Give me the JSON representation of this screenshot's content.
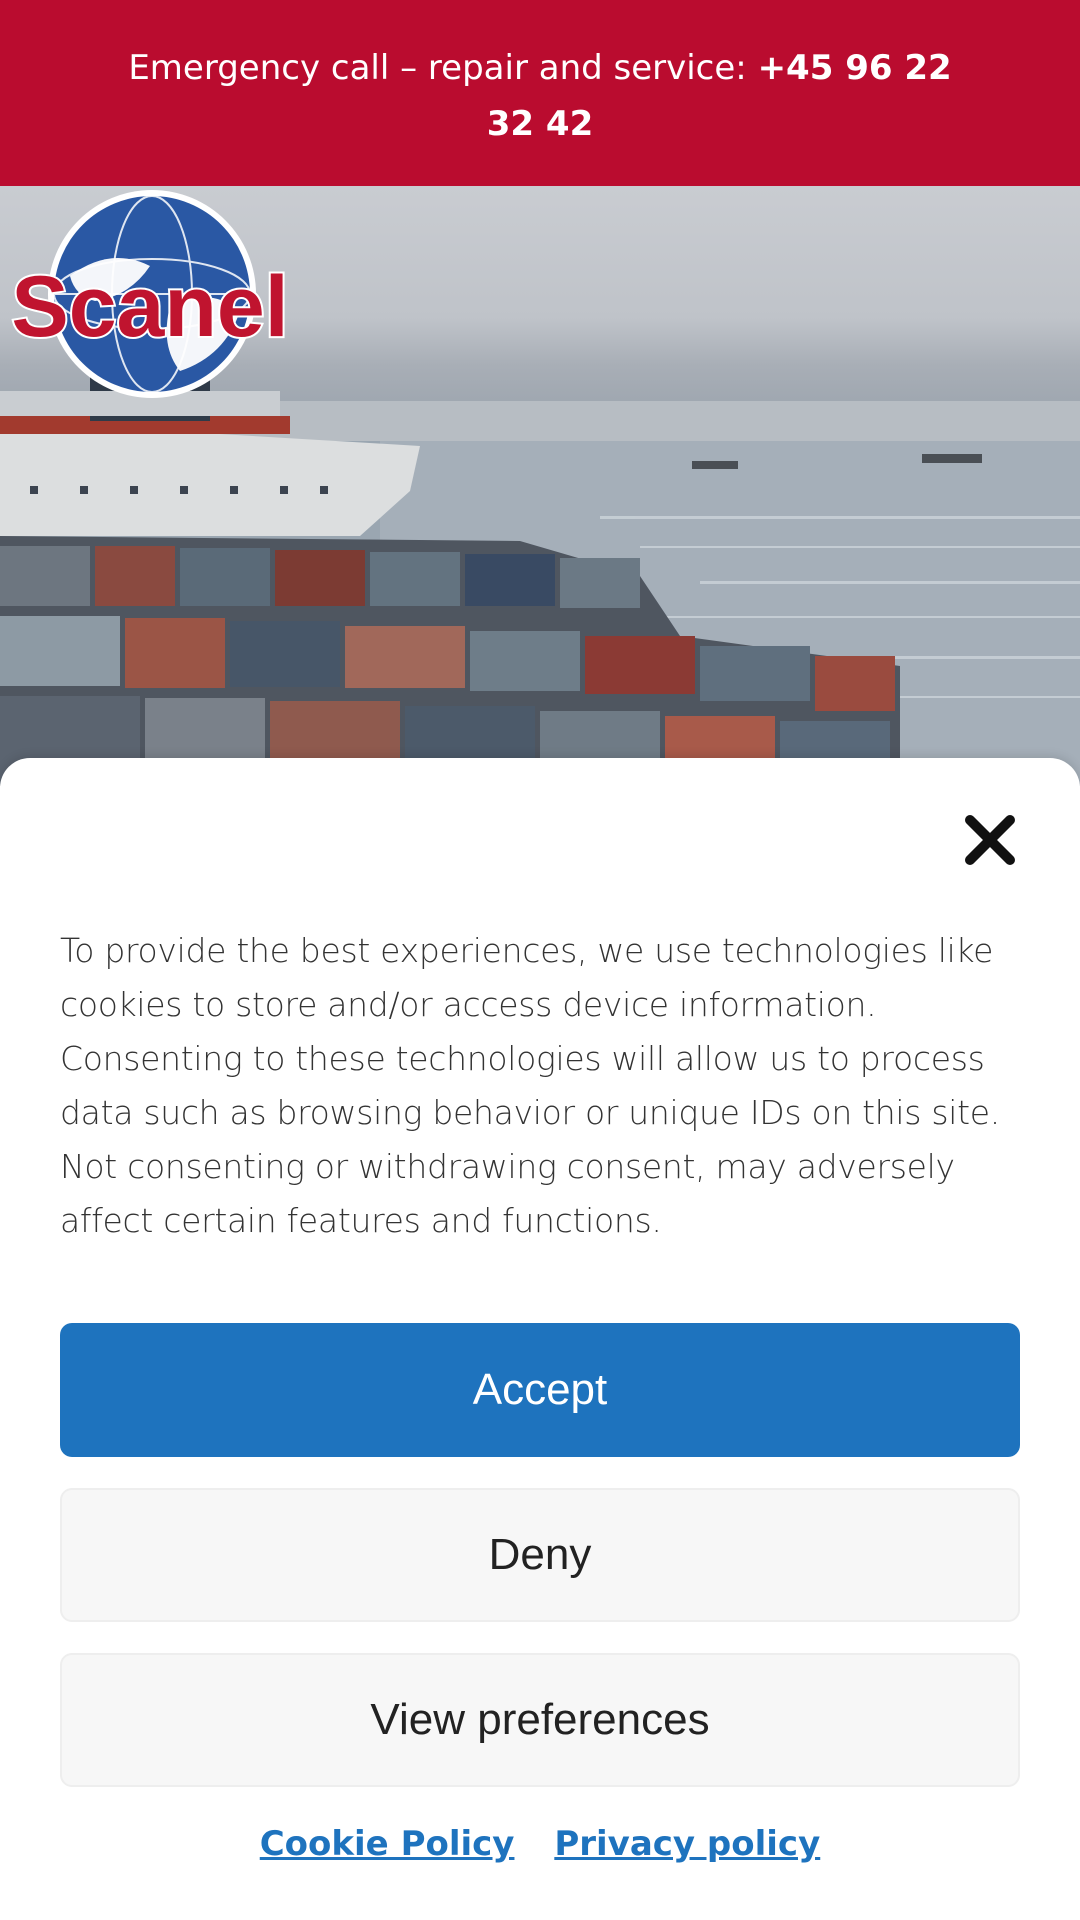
{
  "emergency_bar": {
    "text": "Emergency call – repair and service: ",
    "phone": "+45 96 22 32 42"
  },
  "header": {
    "logo_text": "Scanel"
  },
  "cookie_banner": {
    "message": "To provide the best experiences, we use technologies like cookies to store and/or access device information. Consenting to these technologies will allow us to process data such as browsing behavior or unique IDs on this site. Not consenting or withdrawing consent, may adversely affect certain features and functions.",
    "accept_label": "Accept",
    "deny_label": "Deny",
    "preferences_label": "View preferences",
    "links": [
      {
        "label": "Cookie Policy"
      },
      {
        "label": "Privacy policy"
      }
    ]
  },
  "colors": {
    "brand_red": "#ba0c2f",
    "accent_blue": "#1e73be",
    "logo_blue": "#2a58a4"
  },
  "icons": {
    "menu": "hamburger-menu-icon",
    "close": "close-icon"
  }
}
